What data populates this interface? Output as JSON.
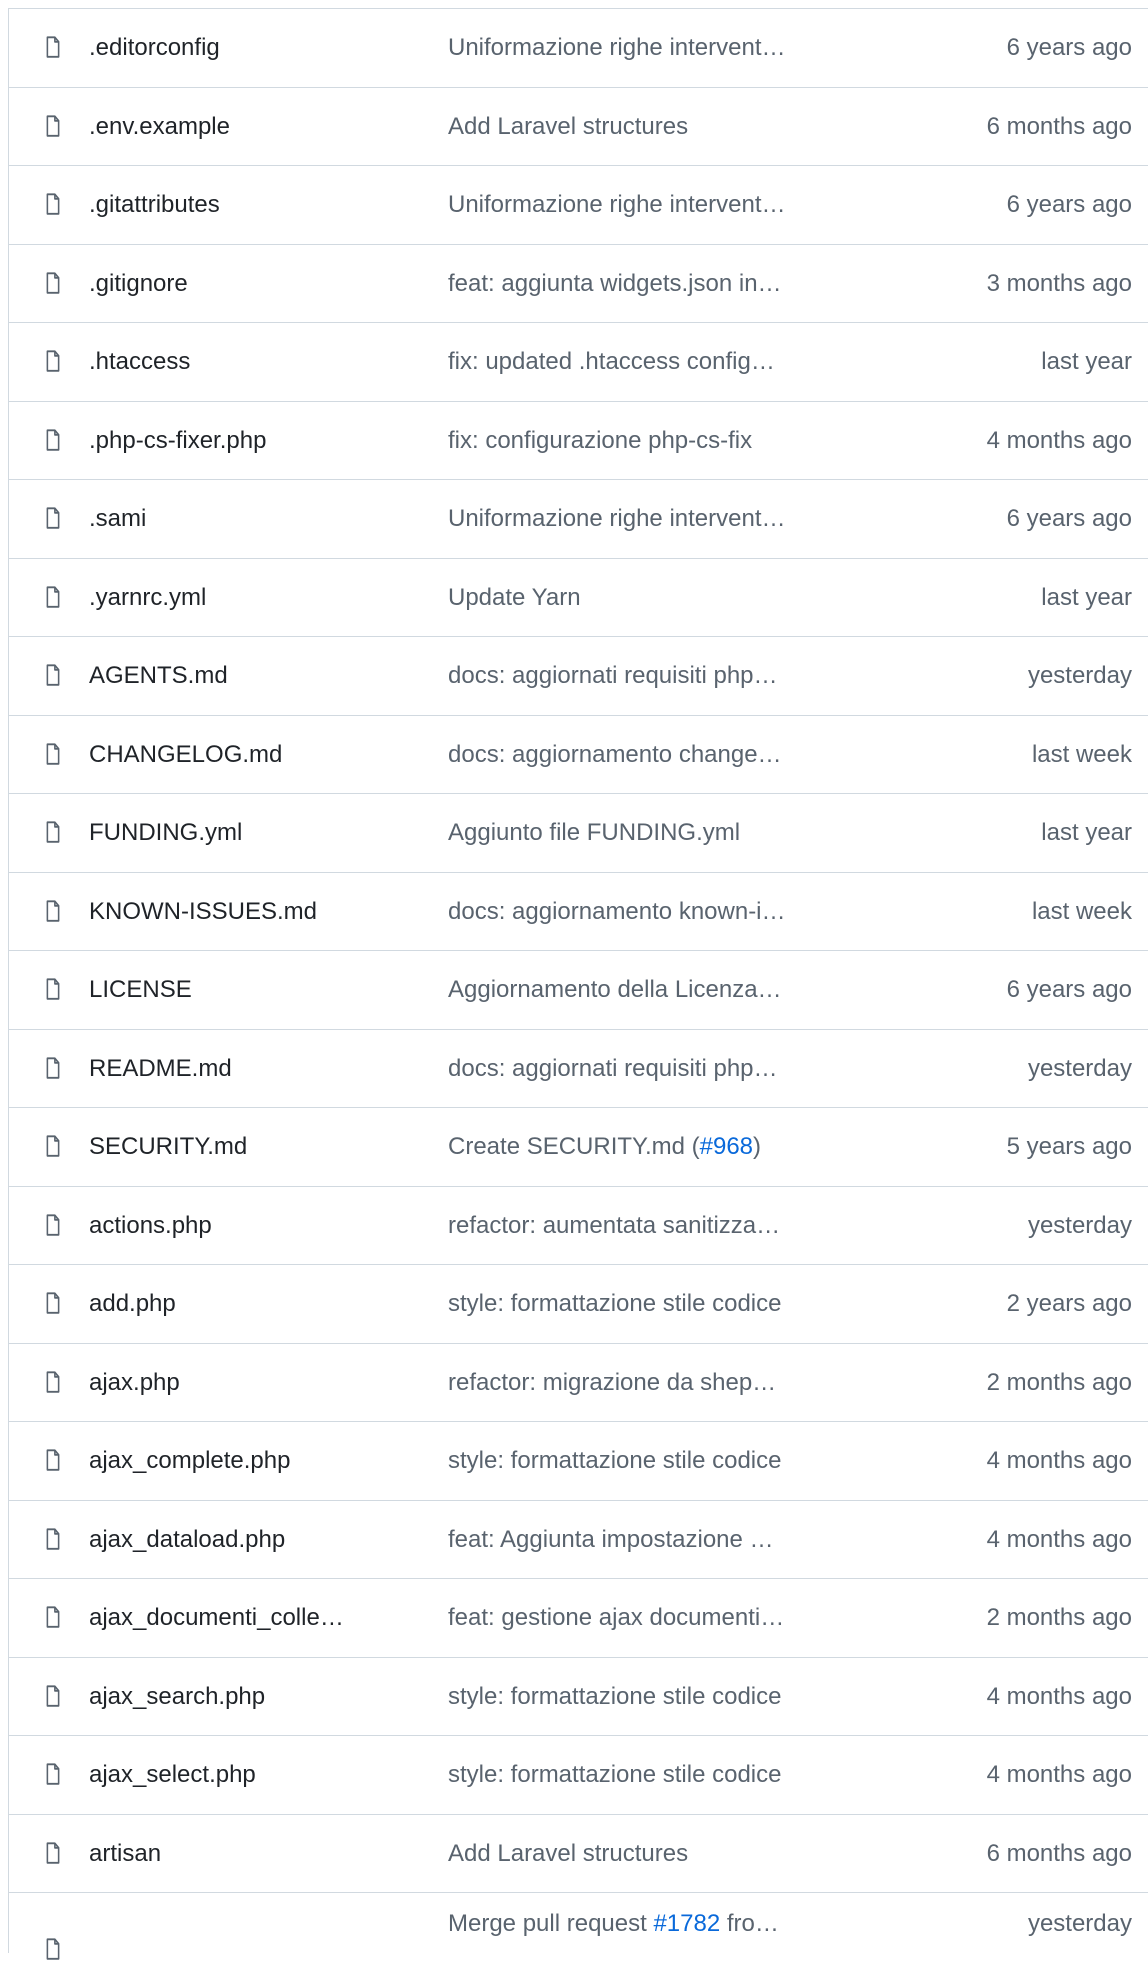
{
  "colors": {
    "border": "#d1d9e0",
    "text_primary": "#1f2328",
    "text_muted": "#59636e",
    "link": "#0969da"
  },
  "icons": {
    "file": "file-icon"
  },
  "files": [
    {
      "name": ".editorconfig",
      "commit": "Uniformazione righe intervent…",
      "time": "6 years ago"
    },
    {
      "name": ".env.example",
      "commit": "Add Laravel structures",
      "time": "6 months ago"
    },
    {
      "name": ".gitattributes",
      "commit": "Uniformazione righe intervent…",
      "time": "6 years ago"
    },
    {
      "name": ".gitignore",
      "commit": "feat: aggiunta widgets.json in…",
      "time": "3 months ago"
    },
    {
      "name": ".htaccess",
      "commit": "fix: updated .htaccess config…",
      "time": "last year"
    },
    {
      "name": ".php-cs-fixer.php",
      "commit": "fix: configurazione php-cs-fix",
      "time": "4 months ago"
    },
    {
      "name": ".sami",
      "commit": "Uniformazione righe intervent…",
      "time": "6 years ago"
    },
    {
      "name": ".yarnrc.yml",
      "commit": "Update Yarn",
      "time": "last year"
    },
    {
      "name": "AGENTS.md",
      "commit": "docs: aggiornati requisiti php…",
      "time": "yesterday"
    },
    {
      "name": "CHANGELOG.md",
      "commit": "docs: aggiornamento change…",
      "time": "last week"
    },
    {
      "name": "FUNDING.yml",
      "commit": "Aggiunto file FUNDING.yml",
      "time": "last year"
    },
    {
      "name": "KNOWN-ISSUES.md",
      "commit": "docs: aggiornamento known-i…",
      "time": "last week"
    },
    {
      "name": "LICENSE",
      "commit": "Aggiornamento della Licenza…",
      "time": "6 years ago"
    },
    {
      "name": "README.md",
      "commit": "docs: aggiornati requisiti php…",
      "time": "yesterday"
    },
    {
      "name": "SECURITY.md",
      "commit_pre": "Create SECURITY.md (",
      "commit_link": "#968",
      "commit_post": ")",
      "time": "5 years ago"
    },
    {
      "name": "actions.php",
      "commit": "refactor: aumentata sanitizza…",
      "time": "yesterday"
    },
    {
      "name": "add.php",
      "commit": "style: formattazione stile codice",
      "time": "2 years ago"
    },
    {
      "name": "ajax.php",
      "commit": "refactor: migrazione da shep…",
      "time": "2 months ago"
    },
    {
      "name": "ajax_complete.php",
      "commit": "style: formattazione stile codice",
      "time": "4 months ago"
    },
    {
      "name": "ajax_dataload.php",
      "commit": "feat: Aggiunta impostazione …",
      "time": "4 months ago"
    },
    {
      "name": "ajax_documenti_colle…",
      "commit": "feat: gestione ajax documenti…",
      "time": "2 months ago"
    },
    {
      "name": "ajax_search.php",
      "commit": "style: formattazione stile codice",
      "time": "4 months ago"
    },
    {
      "name": "ajax_select.php",
      "commit": "style: formattazione stile codice",
      "time": "4 months ago"
    },
    {
      "name": "artisan",
      "commit": "Add Laravel structures",
      "time": "6 months ago"
    },
    {
      "name": "",
      "commit_pre": "Merge pull request ",
      "commit_link": "#1782",
      "commit_post": " fro…",
      "time": "yesterday"
    }
  ]
}
